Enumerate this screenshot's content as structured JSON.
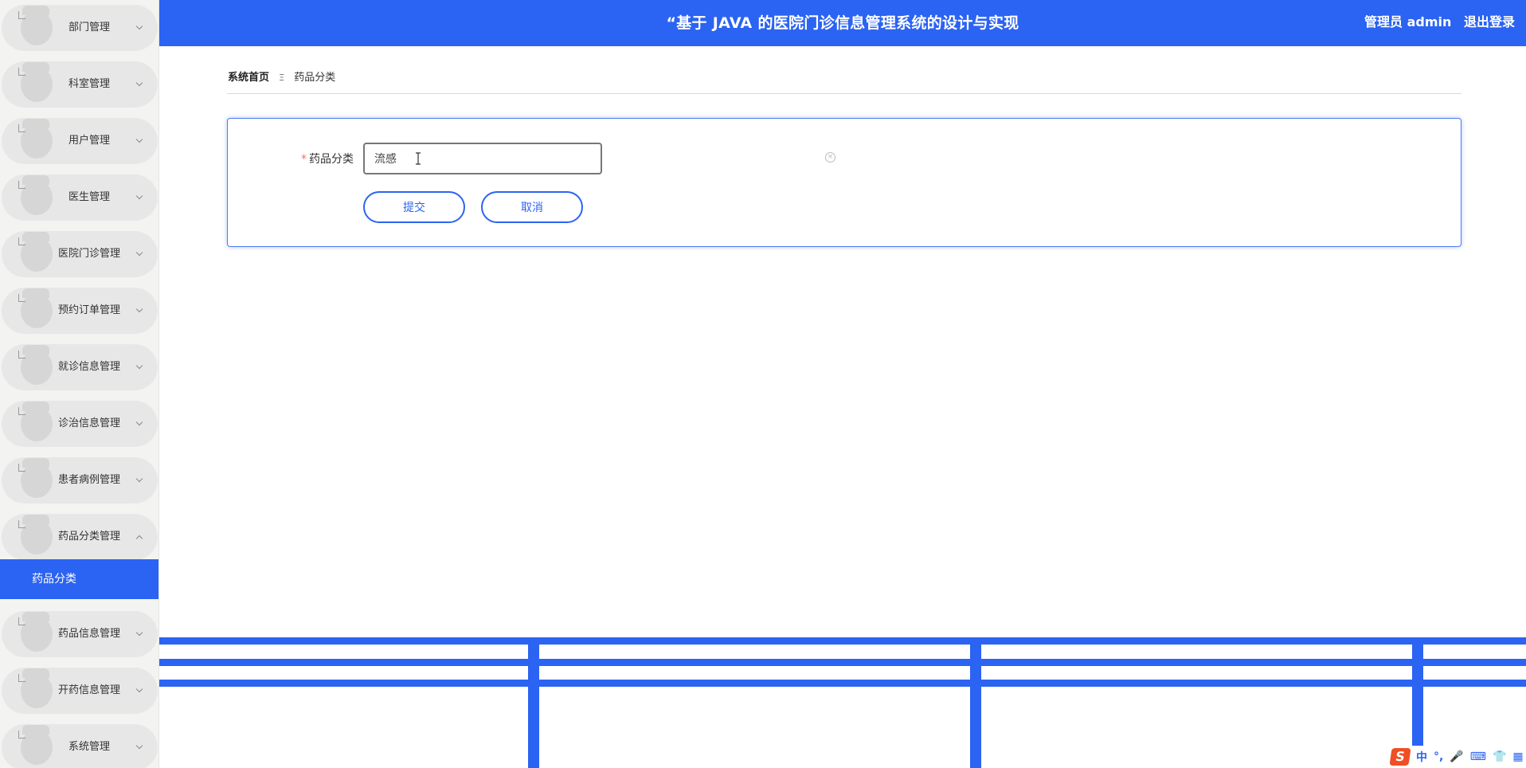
{
  "header": {
    "title": "“基于 JAVA 的医院门诊信息管理系统的设计与实现",
    "user_label": "管理员 admin",
    "logout_label": "退出登录"
  },
  "sidebar": {
    "items": [
      {
        "label": "部门管理",
        "expanded": false
      },
      {
        "label": "科室管理",
        "expanded": false
      },
      {
        "label": "用户管理",
        "expanded": false
      },
      {
        "label": "医生管理",
        "expanded": false
      },
      {
        "label": "医院门诊管理",
        "expanded": false
      },
      {
        "label": "预约订单管理",
        "expanded": false
      },
      {
        "label": "就诊信息管理",
        "expanded": false
      },
      {
        "label": "诊治信息管理",
        "expanded": false
      },
      {
        "label": "患者病例管理",
        "expanded": false
      },
      {
        "label": "药品分类管理",
        "expanded": true
      },
      {
        "label": "药品信息管理",
        "expanded": false
      },
      {
        "label": "开药信息管理",
        "expanded": false
      },
      {
        "label": "系统管理",
        "expanded": false
      }
    ],
    "active_subitem": "药品分类"
  },
  "breadcrumb": {
    "home": "系统首页",
    "separator": "Ξ",
    "current": "药品分类"
  },
  "form": {
    "required_mark": "*",
    "field_label": "药品分类",
    "field_value": "流感",
    "submit_label": "提交",
    "cancel_label": "取消"
  },
  "ime_tray": {
    "logo": "S",
    "items": [
      "中",
      "°,",
      "🎤",
      "⌨",
      "👕",
      "▦"
    ]
  },
  "colors": {
    "primary": "#2b63f2",
    "sidebar_bg": "#f3f3f1",
    "required": "#f56c6c"
  }
}
